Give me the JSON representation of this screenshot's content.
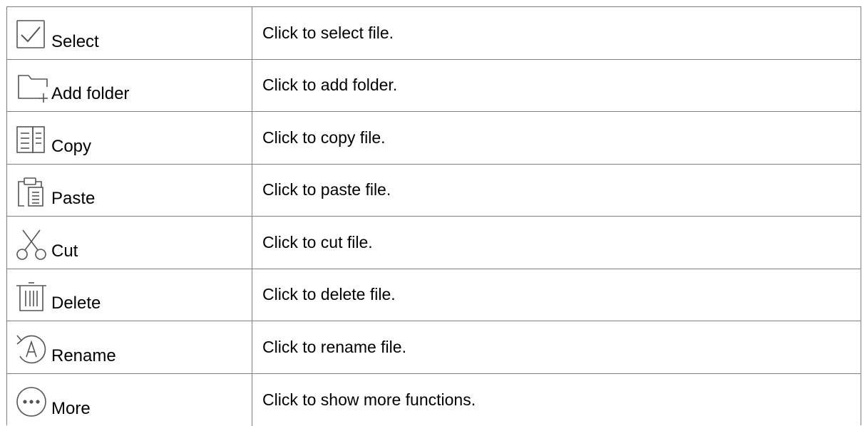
{
  "rows": [
    {
      "icon": "select-icon",
      "label": "Select",
      "description": "Click to select file."
    },
    {
      "icon": "add-folder-icon",
      "label": "Add folder",
      "description": "Click to add folder."
    },
    {
      "icon": "copy-icon",
      "label": "Copy",
      "description": "Click to copy file."
    },
    {
      "icon": "paste-icon",
      "label": "Paste",
      "description": "Click to paste file."
    },
    {
      "icon": "cut-icon",
      "label": "Cut",
      "description": "Click to cut file."
    },
    {
      "icon": "delete-icon",
      "label": "Delete",
      "description": "Click to delete file."
    },
    {
      "icon": "rename-icon",
      "label": "Rename",
      "description": "Click to rename file."
    },
    {
      "icon": "more-icon",
      "label": "More",
      "description": "Click to show more functions."
    }
  ],
  "colors": {
    "border": "#7f7f7f",
    "icon_stroke": "#555555",
    "text": "#000000"
  }
}
